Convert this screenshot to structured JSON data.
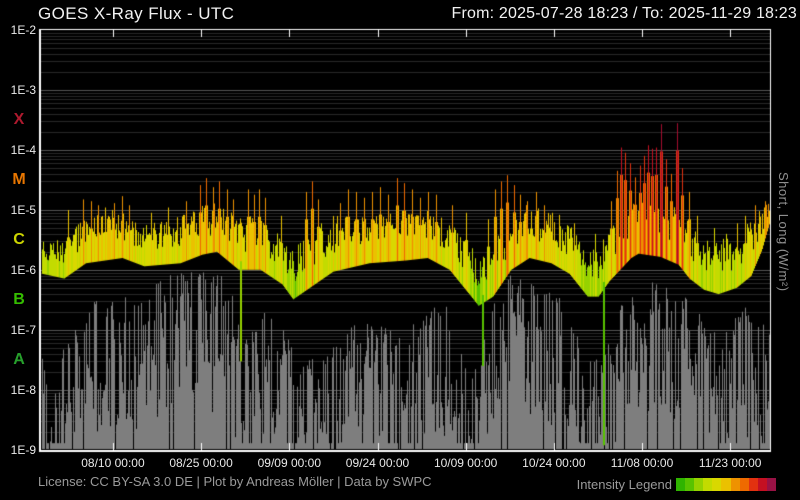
{
  "header": {
    "title": "GOES X-Ray Flux - UTC",
    "date_range": "From: 2025-07-28 18:23  /  To: 2025-11-29 18:23"
  },
  "footer": {
    "license": "License: CC BY-SA 3.0 DE | Plot by Andreas Möller | Data by SWPC",
    "legend_label": "Intensity Legend"
  },
  "right_axis_label": "Short,  Long (W/m²)",
  "chart_data": {
    "type": "line",
    "title": "GOES X-Ray Flux - UTC",
    "from": "2025-07-28 18:23",
    "to": "2025-11-29 18:23",
    "ylabel": "Short, Long (W/m²)",
    "y_scale": "log",
    "y_range": [
      1e-09,
      0.01
    ],
    "grid": {
      "major_color": "#565656",
      "minor_color": "#292929"
    },
    "background": "#000000",
    "border_color": "#ffffff",
    "y_ticks": [
      "1E-2",
      "1E-3",
      "1E-4",
      "1E-5",
      "1E-6",
      "1E-7",
      "1E-8",
      "1E-9"
    ],
    "x_ticks": [
      {
        "label": "08/10 00:00",
        "frac": 0.0987
      },
      {
        "label": "08/25 00:00",
        "frac": 0.2196
      },
      {
        "label": "09/09 00:00",
        "frac": 0.3406
      },
      {
        "label": "09/24 00:00",
        "frac": 0.4616
      },
      {
        "label": "10/09 00:00",
        "frac": 0.5825
      },
      {
        "label": "10/24 00:00",
        "frac": 0.7035
      },
      {
        "label": "11/08 00:00",
        "frac": 0.8245
      },
      {
        "label": "11/23 00:00",
        "frac": 0.9454
      }
    ],
    "class_bands": [
      {
        "label": "X",
        "color": "#ae1a2e",
        "min_flux": 0.0001
      },
      {
        "label": "M",
        "color": "#e87600",
        "min_flux": 1e-05
      },
      {
        "label": "C",
        "color": "#ccd400",
        "min_flux": 1e-06
      },
      {
        "label": "B",
        "color": "#35bd00",
        "min_flux": 1e-07
      },
      {
        "label": "A",
        "color": "#27a02c",
        "min_flux": 1e-08
      }
    ],
    "intensity_scale": [
      {
        "max_flux": 3e-07,
        "color": "#2fb400"
      },
      {
        "max_flux": 7e-07,
        "color": "#58c300"
      },
      {
        "max_flux": 1.5e-06,
        "color": "#96d200"
      },
      {
        "max_flux": 3e-06,
        "color": "#c3db00"
      },
      {
        "max_flux": 6e-06,
        "color": "#d9d800"
      },
      {
        "max_flux": 1.2e-05,
        "color": "#eac100"
      },
      {
        "max_flux": 2.5e-05,
        "color": "#ee9200"
      },
      {
        "max_flux": 5e-05,
        "color": "#ee6a00"
      },
      {
        "max_flux": 0.0001,
        "color": "#e23110"
      },
      {
        "max_flux": 0.0002,
        "color": "#c41022"
      },
      {
        "max_flux": 1,
        "color": "#a50d2e"
      }
    ],
    "legend_colors": [
      "#2fb400",
      "#58c300",
      "#96d200",
      "#c3db00",
      "#d9d800",
      "#eac100",
      "#ee9200",
      "#ee6a00",
      "#e23110",
      "#c41022",
      "#981245"
    ],
    "series": [
      {
        "name": "long",
        "unit": "W/m^2",
        "style": "intensity-colored",
        "envelope_base": [
          [
            0.0,
            1.2e-06
          ],
          [
            0.03,
            1e-06
          ],
          [
            0.06,
            1.8e-06
          ],
          [
            0.11,
            2.2e-06
          ],
          [
            0.14,
            1.6e-06
          ],
          [
            0.19,
            1.8e-06
          ],
          [
            0.22,
            2.5e-06
          ],
          [
            0.24,
            2.8e-06
          ],
          [
            0.27,
            1.4e-06
          ],
          [
            0.3,
            1.4e-06
          ],
          [
            0.33,
            8e-07
          ],
          [
            0.345,
            4.5e-07
          ],
          [
            0.36,
            6e-07
          ],
          [
            0.4,
            1.3e-06
          ],
          [
            0.45,
            1.8e-06
          ],
          [
            0.5,
            2e-06
          ],
          [
            0.53,
            2.2e-06
          ],
          [
            0.56,
            1.4e-06
          ],
          [
            0.59,
            5e-07
          ],
          [
            0.6,
            3.5e-07
          ],
          [
            0.62,
            5e-07
          ],
          [
            0.645,
            1.4e-06
          ],
          [
            0.67,
            2.2e-06
          ],
          [
            0.7,
            1.8e-06
          ],
          [
            0.725,
            1.2e-06
          ],
          [
            0.75,
            5e-07
          ],
          [
            0.765,
            5e-07
          ],
          [
            0.78,
            9e-07
          ],
          [
            0.81,
            2.2e-06
          ],
          [
            0.82,
            2.6e-06
          ],
          [
            0.85,
            2.3e-06
          ],
          [
            0.875,
            1.7e-06
          ],
          [
            0.89,
            1e-06
          ],
          [
            0.91,
            6.5e-07
          ],
          [
            0.93,
            5.5e-07
          ],
          [
            0.955,
            7e-07
          ],
          [
            0.975,
            1.1e-06
          ],
          [
            0.99,
            3e-06
          ],
          [
            1.0,
            8e-06
          ]
        ],
        "envelope_peak": [
          [
            0.0,
            3e-06
          ],
          [
            0.03,
            4e-06
          ],
          [
            0.06,
            8e-06
          ],
          [
            0.11,
            1.1e-05
          ],
          [
            0.14,
            6e-06
          ],
          [
            0.19,
            8e-06
          ],
          [
            0.22,
            1.3e-05
          ],
          [
            0.24,
            1.3e-05
          ],
          [
            0.27,
            8e-06
          ],
          [
            0.3,
            9e-06
          ],
          [
            0.33,
            4e-06
          ],
          [
            0.345,
            2e-06
          ],
          [
            0.36,
            4e-06
          ],
          [
            0.4,
            8e-06
          ],
          [
            0.45,
            9e-06
          ],
          [
            0.5,
            1e-05
          ],
          [
            0.53,
            1.1e-05
          ],
          [
            0.56,
            7e-06
          ],
          [
            0.59,
            2.5e-06
          ],
          [
            0.6,
            2e-06
          ],
          [
            0.62,
            3e-06
          ],
          [
            0.645,
            9e-06
          ],
          [
            0.67,
            1.3e-05
          ],
          [
            0.7,
            1e-05
          ],
          [
            0.725,
            7e-06
          ],
          [
            0.75,
            2.5e-06
          ],
          [
            0.765,
            2.5e-06
          ],
          [
            0.78,
            6e-06
          ],
          [
            0.81,
            1.6e-05
          ],
          [
            0.82,
            1.7e-05
          ],
          [
            0.85,
            1.5e-05
          ],
          [
            0.875,
            1.2e-05
          ],
          [
            0.89,
            6e-06
          ],
          [
            0.91,
            3.5e-06
          ],
          [
            0.93,
            3e-06
          ],
          [
            0.955,
            4.5e-06
          ],
          [
            0.975,
            7e-06
          ],
          [
            0.99,
            1.2e-05
          ],
          [
            1.0,
            1.4e-05
          ]
        ],
        "flares": [
          [
            0.036,
            1e-05
          ],
          [
            0.056,
            1.5e-05
          ],
          [
            0.067,
            1.4e-05
          ],
          [
            0.077,
            1.2e-05
          ],
          [
            0.086,
            1.1e-05
          ],
          [
            0.099,
            1.3e-05
          ],
          [
            0.11,
            1.7e-05
          ],
          [
            0.119,
            1.2e-05
          ],
          [
            0.15,
            9e-06
          ],
          [
            0.174,
            1.1e-05
          ],
          [
            0.198,
            1.4e-05
          ],
          [
            0.218,
            2.6e-05
          ],
          [
            0.226,
            3.4e-05
          ],
          [
            0.235,
            2.4e-05
          ],
          [
            0.244,
            3e-05
          ],
          [
            0.254,
            2.2e-05
          ],
          [
            0.263,
            1.5e-05
          ],
          [
            0.283,
            2.2e-05
          ],
          [
            0.291,
            1.8e-05
          ],
          [
            0.299,
            2.2e-05
          ],
          [
            0.307,
            1.6e-05
          ],
          [
            0.329,
            8e-06
          ],
          [
            0.363,
            2e-05
          ],
          [
            0.372,
            3e-05
          ],
          [
            0.38,
            1.5e-05
          ],
          [
            0.41,
            1.3e-05
          ],
          [
            0.421,
            2.2e-05
          ],
          [
            0.432,
            2e-05
          ],
          [
            0.443,
            1.6e-05
          ],
          [
            0.454,
            2e-05
          ],
          [
            0.465,
            2.4e-05
          ],
          [
            0.476,
            1.8e-05
          ],
          [
            0.488,
            3.4e-05
          ],
          [
            0.498,
            2.8e-05
          ],
          [
            0.509,
            2.2e-05
          ],
          [
            0.52,
            1.6e-05
          ],
          [
            0.531,
            2e-05
          ],
          [
            0.542,
            1.8e-05
          ],
          [
            0.564,
            1.2e-05
          ],
          [
            0.583,
            9e-06
          ],
          [
            0.613,
            7e-06
          ],
          [
            0.623,
            2.2e-05
          ],
          [
            0.632,
            3e-05
          ],
          [
            0.64,
            3.8e-05
          ],
          [
            0.649,
            2.6e-05
          ],
          [
            0.658,
            1.8e-05
          ],
          [
            0.667,
            1.4e-05
          ],
          [
            0.679,
            2e-05
          ],
          [
            0.69,
            1.2e-05
          ],
          [
            0.701,
            9e-06
          ],
          [
            0.732,
            6e-06
          ],
          [
            0.761,
            4e-06
          ],
          [
            0.783,
            1.4e-05
          ],
          [
            0.791,
            4.5e-05
          ],
          [
            0.797,
            0.00011
          ],
          [
            0.802,
            9e-05
          ],
          [
            0.809,
            6e-05
          ],
          [
            0.816,
            3.5e-05
          ],
          [
            0.823,
            5.5e-05
          ],
          [
            0.828,
            8e-05
          ],
          [
            0.834,
            0.00012
          ],
          [
            0.839,
            0.000105
          ],
          [
            0.845,
            0.00011
          ],
          [
            0.852,
            0.00027
          ],
          [
            0.859,
            7e-05
          ],
          [
            0.865,
            4e-05
          ],
          [
            0.874,
            0.00028
          ],
          [
            0.881,
            5e-05
          ],
          [
            0.89,
            2e-05
          ],
          [
            0.901,
            8e-06
          ],
          [
            0.924,
            5e-06
          ],
          [
            0.941,
            4e-06
          ],
          [
            0.956,
            6e-06
          ],
          [
            0.967,
            8e-06
          ],
          [
            0.981,
            1.2e-05
          ],
          [
            0.994,
            1.4e-05
          ]
        ],
        "down_gaps": [
          [
            0.272,
            3e-08
          ],
          [
            0.605,
            2.5e-08
          ],
          [
            0.771,
            1.2e-09
          ]
        ]
      },
      {
        "name": "short",
        "unit": "W/m^2",
        "style": "gray-band",
        "color": "#7e7e7e",
        "envelope_max": [
          [
            0.0,
            4e-08
          ],
          [
            0.019,
            3e-08
          ],
          [
            0.04,
            8e-08
          ],
          [
            0.06,
            2e-07
          ],
          [
            0.081,
            4e-07
          ],
          [
            0.101,
            5e-07
          ],
          [
            0.122,
            4e-07
          ],
          [
            0.143,
            5e-07
          ],
          [
            0.163,
            7e-07
          ],
          [
            0.184,
            9e-07
          ],
          [
            0.204,
            1e-06
          ],
          [
            0.225,
            9e-07
          ],
          [
            0.246,
            8e-07
          ],
          [
            0.266,
            3e-07
          ],
          [
            0.284,
            8e-08
          ],
          [
            0.303,
            2e-07
          ],
          [
            0.325,
            1.5e-07
          ],
          [
            0.344,
            5e-08
          ],
          [
            0.362,
            3e-08
          ],
          [
            0.383,
            4e-08
          ],
          [
            0.403,
            6e-08
          ],
          [
            0.424,
            1.2e-07
          ],
          [
            0.444,
            1.5e-07
          ],
          [
            0.465,
            1.2e-07
          ],
          [
            0.486,
            9e-08
          ],
          [
            0.506,
            1.2e-07
          ],
          [
            0.527,
            1.8e-07
          ],
          [
            0.547,
            3e-07
          ],
          [
            0.564,
            2e-07
          ],
          [
            0.582,
            4e-08
          ],
          [
            0.599,
            2.5e-08
          ],
          [
            0.616,
            3e-07
          ],
          [
            0.636,
            8e-07
          ],
          [
            0.657,
            1e-06
          ],
          [
            0.673,
            7e-07
          ],
          [
            0.691,
            4e-07
          ],
          [
            0.709,
            5e-07
          ],
          [
            0.726,
            2e-07
          ],
          [
            0.742,
            6e-08
          ],
          [
            0.76,
            3e-08
          ],
          [
            0.778,
            8e-08
          ],
          [
            0.794,
            3e-07
          ],
          [
            0.811,
            5e-07
          ],
          [
            0.828,
            6e-07
          ],
          [
            0.846,
            7e-07
          ],
          [
            0.863,
            5e-07
          ],
          [
            0.879,
            4e-07
          ],
          [
            0.897,
            2.5e-07
          ],
          [
            0.915,
            1.2e-07
          ],
          [
            0.931,
            8e-08
          ],
          [
            0.949,
            1.5e-07
          ],
          [
            0.967,
            2.5e-07
          ],
          [
            0.983,
            2e-07
          ],
          [
            1.0,
            1e-07
          ]
        ]
      }
    ]
  }
}
